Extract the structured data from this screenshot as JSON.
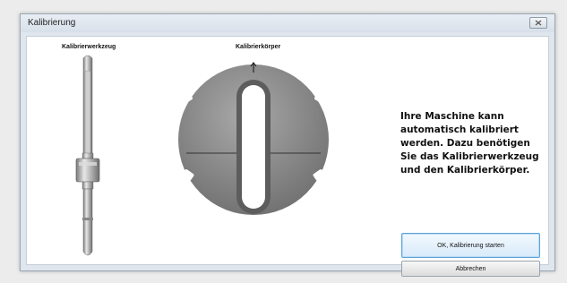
{
  "window": {
    "title": "Kalibrierung"
  },
  "labels": {
    "tool": "Kalibrierwerkzeug",
    "body": "Kalibrierkörper"
  },
  "message": "Ihre Maschine kann automatisch kalibriert werden. Dazu benötigen Sie das Kalibrierwerkzeug und den Kalibrierkörper.",
  "buttons": {
    "ok": "OK, Kalibrierung starten",
    "cancel": "Abbrechen"
  },
  "icons": {
    "close": "close-icon",
    "arrow": "arrow-up-icon"
  }
}
